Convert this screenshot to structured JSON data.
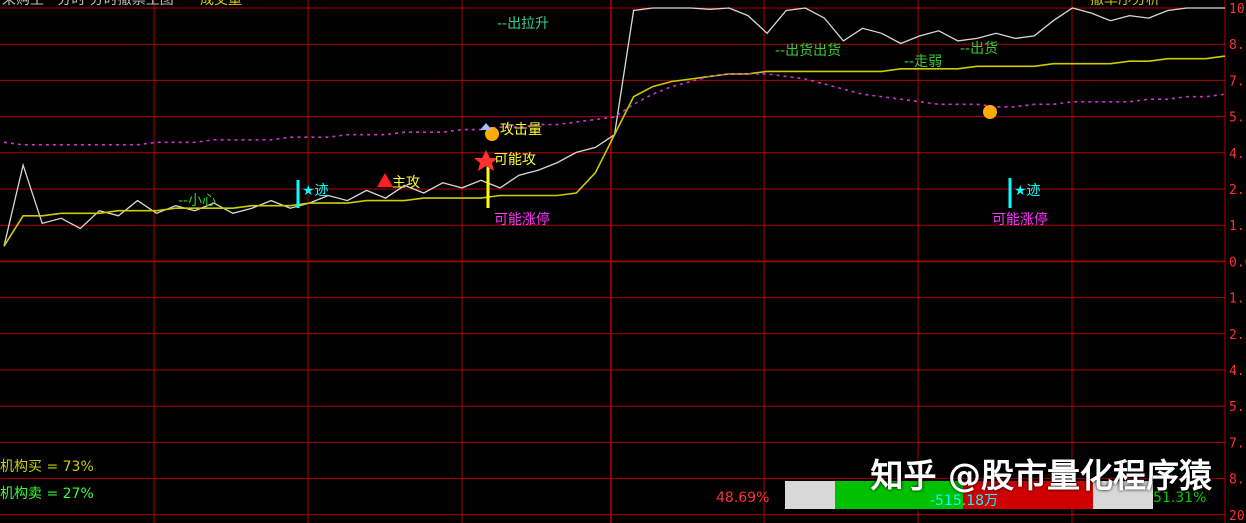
{
  "header": {
    "left_text": "采购主 · 分时 分时撤票主图",
    "left_extra": "成交量",
    "right_text": "撤单序分析"
  },
  "y_axis_labels": [
    "10",
    "8.",
    "7.",
    "5.",
    "4.",
    "2.",
    "1.",
    "0.0",
    "1.",
    "2.",
    "4.",
    "5.",
    "7.",
    "8.",
    "20"
  ],
  "annotations": {
    "chuxiao": "--小心",
    "zhugong": "主攻",
    "ji_1": "★迹",
    "ji_2": "★迹",
    "kenengzhangting_1": "可能涨停",
    "kenengzhangting_2": "可能涨停",
    "gongjiliang": "攻击量",
    "kenenggong": "可能攻",
    "chujijian": "--出拉升",
    "chuhuoxian": "--出货出货",
    "zouruo": "--走弱",
    "chuhuo": "--出货"
  },
  "bottom": {
    "inst_buy": "机构买 = 73%",
    "inst_sell": "机构卖 = 27%",
    "pct_left": "48.69%",
    "bar_mid": "-515.18万",
    "pct_right": "51.31%",
    "watermark": "知乎 @股市量化程序猿"
  },
  "colors": {
    "background": "#000000",
    "grid": "#b00000",
    "price_line": "#d8d8d8",
    "avg_line": "#cccc00",
    "ma_dotted": "#cc33cc",
    "cyan": "#00ffff",
    "magenta": "#ff33ff",
    "green_text": "#33ff33",
    "yellow_text": "#ffff33",
    "bar_green": "#00c000",
    "bar_red": "#d00000",
    "bar_gray": "#d8d8d8"
  },
  "chart_data": {
    "type": "line",
    "xlabel": "",
    "ylabel": "",
    "ylim": [
      -20,
      10
    ],
    "series": [
      {
        "values": [
          0.6,
          3.8,
          1.5,
          1.7,
          1.3,
          2.0,
          1.8,
          2.4,
          1.9,
          2.2,
          2.0,
          2.3,
          1.9,
          2.1,
          2.4,
          2.1,
          2.3,
          2.6,
          2.4,
          2.8,
          2.5,
          3.0,
          2.7,
          3.1,
          2.9,
          3.2,
          2.9,
          3.4,
          3.6,
          3.9,
          4.3,
          4.5,
          5.0,
          9.9,
          10,
          10,
          10,
          9.95,
          10,
          9.7,
          9.0,
          9.9,
          10,
          9.6,
          8.7,
          9.2,
          9.0,
          8.6,
          8.9,
          9.1,
          8.7,
          8.8,
          9.0,
          8.8,
          8.9,
          9.5,
          10,
          9.8,
          9.5,
          9.7,
          9.6,
          9.9,
          10,
          10,
          10
        ]
      },
      {
        "values": [
          0.6,
          1.8,
          1.8,
          1.9,
          1.9,
          1.9,
          2.0,
          2.0,
          2.0,
          2.1,
          2.1,
          2.1,
          2.1,
          2.2,
          2.2,
          2.2,
          2.3,
          2.3,
          2.3,
          2.4,
          2.4,
          2.4,
          2.5,
          2.5,
          2.5,
          2.5,
          2.6,
          2.6,
          2.6,
          2.6,
          2.7,
          3.5,
          5.0,
          6.5,
          6.9,
          7.1,
          7.2,
          7.3,
          7.4,
          7.4,
          7.5,
          7.5,
          7.5,
          7.5,
          7.5,
          7.5,
          7.5,
          7.6,
          7.6,
          7.6,
          7.6,
          7.7,
          7.7,
          7.7,
          7.7,
          7.8,
          7.8,
          7.8,
          7.8,
          7.9,
          7.9,
          8.0,
          8.0,
          8.0,
          8.1
        ]
      },
      {
        "values": [
          4.7,
          4.6,
          4.6,
          4.6,
          4.6,
          4.6,
          4.6,
          4.6,
          4.7,
          4.7,
          4.7,
          4.8,
          4.8,
          4.8,
          4.8,
          4.9,
          4.9,
          4.9,
          5.0,
          5.0,
          5.0,
          5.1,
          5.1,
          5.1,
          5.2,
          5.2,
          5.3,
          5.3,
          5.4,
          5.4,
          5.5,
          5.6,
          5.7,
          6.2,
          6.6,
          6.9,
          7.1,
          7.3,
          7.4,
          7.4,
          7.4,
          7.3,
          7.2,
          7.0,
          6.8,
          6.6,
          6.5,
          6.4,
          6.3,
          6.2,
          6.2,
          6.2,
          6.1,
          6.1,
          6.2,
          6.2,
          6.3,
          6.3,
          6.3,
          6.3,
          6.4,
          6.4,
          6.5,
          6.5,
          6.6
        ]
      }
    ]
  }
}
